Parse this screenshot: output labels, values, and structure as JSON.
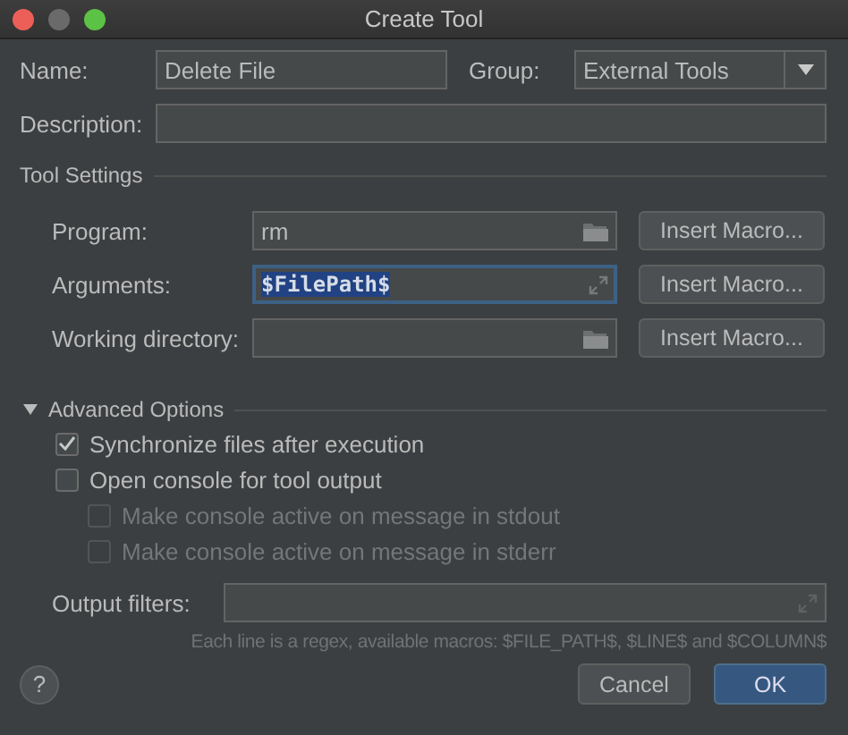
{
  "window": {
    "title": "Create Tool"
  },
  "name": {
    "label": "Name:",
    "value": "Delete File"
  },
  "group": {
    "label": "Group:",
    "value": "External Tools"
  },
  "description": {
    "label": "Description:"
  },
  "tool_settings": {
    "title": "Tool Settings",
    "rows": [
      {
        "label": "Program:",
        "value": "rm",
        "kind": "path",
        "focused": false,
        "button": "Insert Macro..."
      },
      {
        "label": "Arguments:",
        "value": "$FilePath$",
        "kind": "text",
        "focused": true,
        "button": "Insert Macro..."
      },
      {
        "label": "Working directory:",
        "kind": "path",
        "focused": false,
        "button": "Insert Macro..."
      }
    ]
  },
  "advanced": {
    "title": "Advanced Options",
    "expanded": true,
    "options": [
      {
        "label": "Synchronize files after execution",
        "checked": true,
        "disabled": false,
        "nested": false
      },
      {
        "label": "Open console for tool output",
        "checked": false,
        "disabled": false,
        "nested": false
      },
      {
        "label": "Make console active on message in stdout",
        "checked": false,
        "disabled": true,
        "nested": true
      },
      {
        "label": "Make console active on message in stderr",
        "checked": false,
        "disabled": true,
        "nested": true
      }
    ],
    "output_filters": {
      "label": "Output filters:",
      "hint": "Each line is a regex, available macros: $FILE_PATH$, $LINE$ and $COLUMN$"
    }
  },
  "help": {
    "label": "?"
  },
  "buttons": [
    {
      "label": "Cancel",
      "default": false
    },
    {
      "label": "OK",
      "default": true
    }
  ]
}
